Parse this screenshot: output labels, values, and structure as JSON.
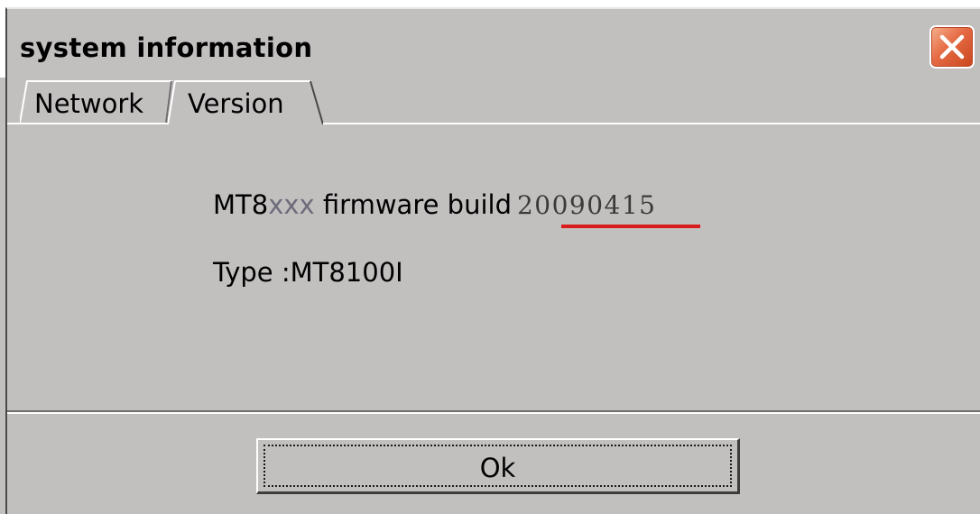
{
  "window": {
    "title": "system information"
  },
  "tabs": [
    {
      "label": "Network",
      "active": false
    },
    {
      "label": "Version",
      "active": true
    }
  ],
  "version_panel": {
    "firmware_prefix": "MT8",
    "firmware_model_suffix": "xxx",
    "firmware_text": "firmware build",
    "build_number": "20090415",
    "type_label": "Type :",
    "type_value": "MT8100I"
  },
  "buttons": {
    "ok_label": "Ok"
  },
  "icons": {
    "close": "close-x-icon"
  },
  "colors": {
    "window_bg": "#c2bfbf",
    "close_button": "#e56a43",
    "highlight_underline": "#d91d1d"
  }
}
